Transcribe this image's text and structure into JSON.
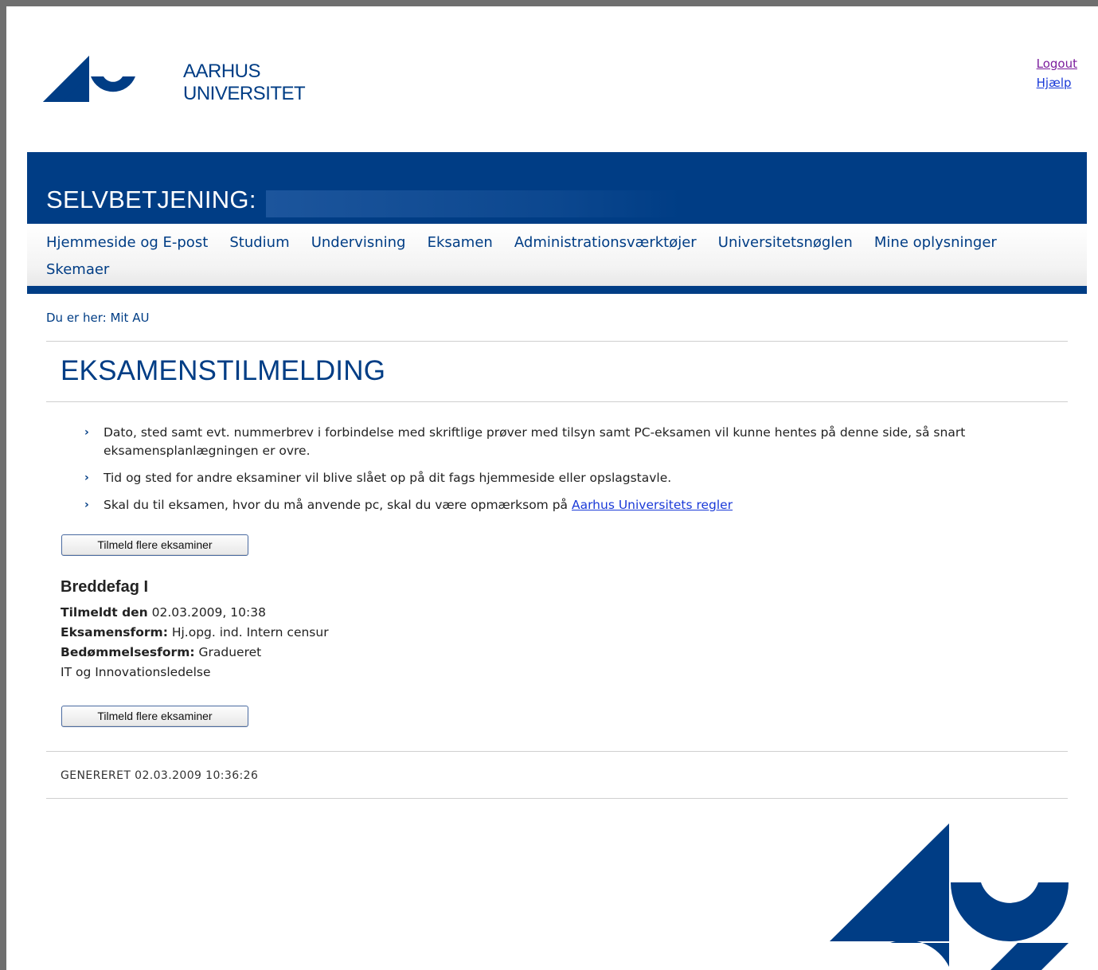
{
  "header": {
    "logo_text_line1": "AARHUS",
    "logo_text_line2": "UNIVERSITET",
    "logout_label": "Logout",
    "help_label": "Hjælp"
  },
  "banner": {
    "title": "SELVBETJENING:"
  },
  "nav": {
    "items": [
      "Hjemmeside og E-post",
      "Studium",
      "Undervisning",
      "Eksamen",
      "Administrationsværktøjer",
      "Universitetsnøglen",
      "Mine oplysninger",
      "Skemaer"
    ]
  },
  "breadcrumb": "Du er her: Mit AU",
  "page_title": "EKSAMENSTILMELDING",
  "info": {
    "items": [
      "Dato, sted samt evt. nummerbrev i forbindelse med skriftlige prøver med tilsyn samt PC-eksamen vil kunne hentes på denne side, så snart eksamensplanlægningen er ovre.",
      "Tid og sted for andre eksaminer vil blive slået op på dit fags hjemmeside eller opslagstavle.",
      "Skal du til eksamen, hvor du må anvende pc, skal du være opmærksom på "
    ],
    "rules_link": "Aarhus Universitets regler"
  },
  "button_label": "Tilmeld flere eksaminer",
  "course": {
    "title": "Breddefag I",
    "registered_label": "Tilmeldt den",
    "registered_value": "02.03.2009, 10:38",
    "exam_form_label": "Eksamensform:",
    "exam_form_value": "Hj.opg. ind. Intern censur",
    "grading_label": "Bedømmelsesform:",
    "grading_value": "Gradueret",
    "subject": "IT og Innovationsledelse"
  },
  "generated": "GENERERET 02.03.2009 10:36:26",
  "colors": {
    "brand": "#003d85",
    "link": "#1a3ad8",
    "visited": "#7b1d9d"
  }
}
